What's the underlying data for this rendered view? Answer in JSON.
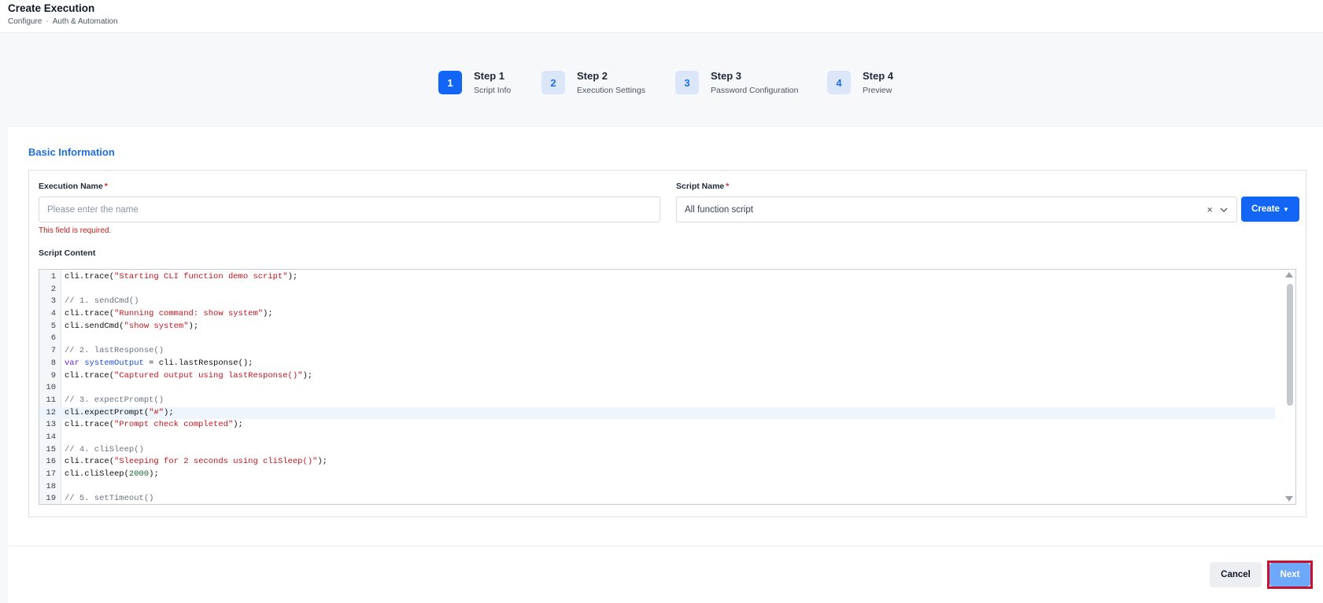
{
  "header": {
    "title": "Create Execution",
    "breadcrumb": [
      "Configure",
      "Auth & Automation"
    ],
    "breadcrumb_separator": "-"
  },
  "steps": [
    {
      "number": "1",
      "title": "Step 1",
      "subtitle": "Script Info",
      "active": true
    },
    {
      "number": "2",
      "title": "Step 2",
      "subtitle": "Execution Settings",
      "active": false
    },
    {
      "number": "3",
      "title": "Step 3",
      "subtitle": "Password Configuration",
      "active": false
    },
    {
      "number": "4",
      "title": "Step 4",
      "subtitle": "Preview",
      "active": false
    }
  ],
  "form": {
    "section_title": "Basic Information",
    "required_marker": "*",
    "execution_name": {
      "label": "Execution Name",
      "value": "",
      "placeholder": "Please enter the name",
      "error": "This field is required."
    },
    "script_name": {
      "label": "Script Name",
      "value": "All function script",
      "clear_icon": "close-icon",
      "dropdown_icon": "chevron-down-icon"
    },
    "create_button": {
      "label": "Create",
      "icon": "caret-down-icon"
    },
    "script_content": {
      "label": "Script Content",
      "active_line": 12,
      "lines": [
        {
          "n": "1",
          "tokens": [
            {
              "t": "plain",
              "v": "cli.trace("
            },
            {
              "t": "string",
              "v": "\"Starting CLI function demo script\""
            },
            {
              "t": "plain",
              "v": ");"
            }
          ]
        },
        {
          "n": "2",
          "tokens": []
        },
        {
          "n": "3",
          "tokens": [
            {
              "t": "comment",
              "v": "// 1. sendCmd()"
            }
          ]
        },
        {
          "n": "4",
          "tokens": [
            {
              "t": "plain",
              "v": "cli.trace("
            },
            {
              "t": "string",
              "v": "\"Running command: show system\""
            },
            {
              "t": "plain",
              "v": ");"
            }
          ]
        },
        {
          "n": "5",
          "tokens": [
            {
              "t": "plain",
              "v": "cli.sendCmd("
            },
            {
              "t": "string",
              "v": "\"show system\""
            },
            {
              "t": "plain",
              "v": ");"
            }
          ]
        },
        {
          "n": "6",
          "tokens": []
        },
        {
          "n": "7",
          "tokens": [
            {
              "t": "comment",
              "v": "// 2. lastResponse()"
            }
          ]
        },
        {
          "n": "8",
          "tokens": [
            {
              "t": "keyword",
              "v": "var"
            },
            {
              "t": "plain",
              "v": " "
            },
            {
              "t": "variable",
              "v": "systemOutput"
            },
            {
              "t": "plain",
              "v": " = cli.lastResponse();"
            }
          ]
        },
        {
          "n": "9",
          "tokens": [
            {
              "t": "plain",
              "v": "cli.trace("
            },
            {
              "t": "string",
              "v": "\"Captured output using lastResponse()\""
            },
            {
              "t": "plain",
              "v": ");"
            }
          ]
        },
        {
          "n": "10",
          "tokens": []
        },
        {
          "n": "11",
          "tokens": [
            {
              "t": "comment",
              "v": "// 3. expectPrompt()"
            }
          ]
        },
        {
          "n": "12",
          "tokens": [
            {
              "t": "plain",
              "v": "cli.expectPrompt("
            },
            {
              "t": "string",
              "v": "\"#\""
            },
            {
              "t": "plain",
              "v": ");"
            }
          ]
        },
        {
          "n": "13",
          "tokens": [
            {
              "t": "plain",
              "v": "cli.trace("
            },
            {
              "t": "string",
              "v": "\"Prompt check completed\""
            },
            {
              "t": "plain",
              "v": ");"
            }
          ]
        },
        {
          "n": "14",
          "tokens": []
        },
        {
          "n": "15",
          "tokens": [
            {
              "t": "comment",
              "v": "// 4. cliSleep()"
            }
          ]
        },
        {
          "n": "16",
          "tokens": [
            {
              "t": "plain",
              "v": "cli.trace("
            },
            {
              "t": "string",
              "v": "\"Sleeping for 2 seconds using cliSleep()\""
            },
            {
              "t": "plain",
              "v": ");"
            }
          ]
        },
        {
          "n": "17",
          "tokens": [
            {
              "t": "plain",
              "v": "cli.cliSleep("
            },
            {
              "t": "number",
              "v": "2000"
            },
            {
              "t": "plain",
              "v": ");"
            }
          ]
        },
        {
          "n": "18",
          "tokens": []
        },
        {
          "n": "19",
          "tokens": [
            {
              "t": "comment",
              "v": "// 5. setTimeout()"
            }
          ]
        }
      ]
    }
  },
  "footer": {
    "cancel_label": "Cancel",
    "next_label": "Next"
  },
  "colors": {
    "primary": "#1366f5",
    "section_title": "#1f6fe5",
    "error": "#b91c1c",
    "next_disabled": "#6ea8fb",
    "highlight": "#c8102e"
  }
}
